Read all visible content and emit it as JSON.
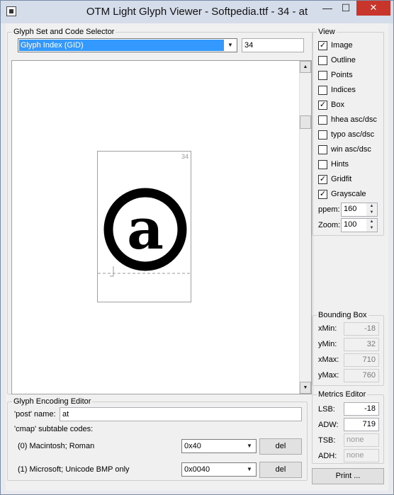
{
  "window": {
    "title": "OTM Light Glyph Viewer - Softpedia.ttf - 34 - at",
    "minimize_glyph": "—",
    "maximize_glyph": "☐",
    "close_glyph": "✕"
  },
  "selector": {
    "group_title": "Glyph Set and Code Selector",
    "mode_value": "Glyph Index (GID)",
    "code_value": "34"
  },
  "canvas": {
    "glyph_index": "34",
    "glyph_char": "a"
  },
  "view": {
    "group_title": "View",
    "options": [
      {
        "label": "Image",
        "checked": true
      },
      {
        "label": "Outline",
        "checked": false
      },
      {
        "label": "Points",
        "checked": false
      },
      {
        "label": "Indices",
        "checked": false
      },
      {
        "label": "Box",
        "checked": true
      },
      {
        "label": "hhea asc/dsc",
        "checked": false
      },
      {
        "label": "typo asc/dsc",
        "checked": false
      },
      {
        "label": "win asc/dsc",
        "checked": false
      },
      {
        "label": "Hints",
        "checked": false
      },
      {
        "label": "Gridfit",
        "checked": true
      },
      {
        "label": "Grayscale",
        "checked": true
      }
    ],
    "ppem_label": "ppem:",
    "ppem_value": "160",
    "zoom_label": "Zoom:",
    "zoom_value": "100"
  },
  "bbox": {
    "group_title": "Bounding Box",
    "xmin_label": "xMin:",
    "xmin_value": "-18",
    "ymin_label": "yMin:",
    "ymin_value": "32",
    "xmax_label": "xMax:",
    "xmax_value": "710",
    "ymax_label": "yMax:",
    "ymax_value": "760"
  },
  "metrics": {
    "group_title": "Metrics Editor",
    "lsb_label": "LSB:",
    "lsb_value": "-18",
    "adw_label": "ADW:",
    "adw_value": "719",
    "tsb_label": "TSB:",
    "tsb_value": "none",
    "adh_label": "ADH:",
    "adh_value": "none"
  },
  "encoding": {
    "group_title": "Glyph Encoding Editor",
    "post_label": "'post' name:",
    "post_value": "at",
    "cmap_label": "'cmap' subtable codes:",
    "rows": [
      {
        "label": "(0) Macintosh; Roman",
        "code": "0x40",
        "del": "del"
      },
      {
        "label": "(1) Microsoft; Unicode BMP only",
        "code": "0x0040",
        "del": "del"
      }
    ]
  },
  "print_label": "Print ..."
}
